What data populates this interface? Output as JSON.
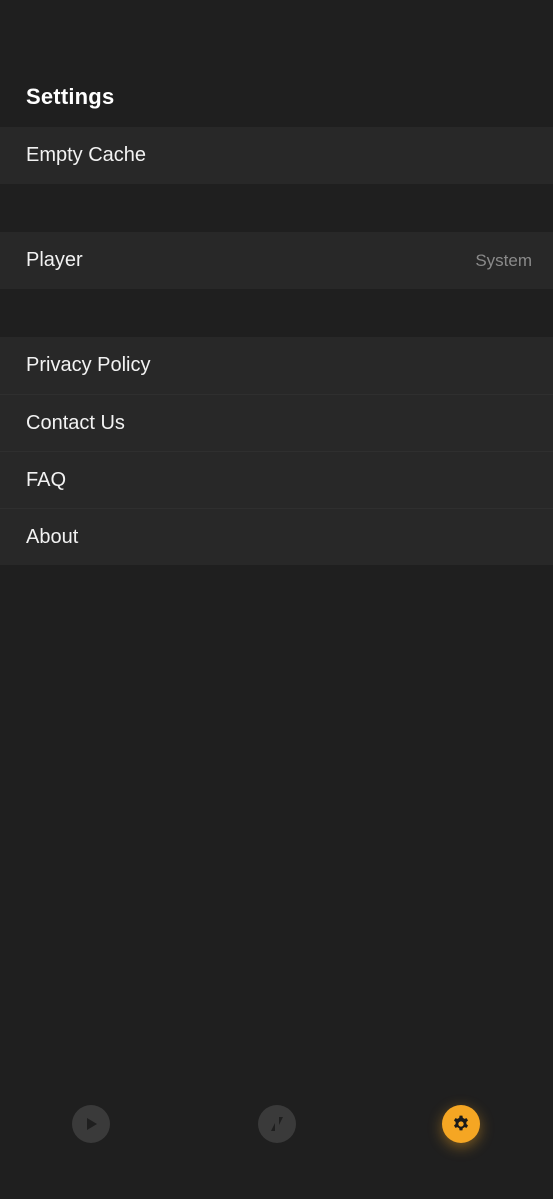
{
  "header": {
    "title": "Settings"
  },
  "groups": [
    {
      "items": [
        {
          "label": "Empty Cache"
        }
      ]
    },
    {
      "items": [
        {
          "label": "Player",
          "value": "System"
        }
      ]
    },
    {
      "items": [
        {
          "label": "Privacy Policy"
        },
        {
          "label": "Contact Us"
        },
        {
          "label": "FAQ"
        },
        {
          "label": "About"
        }
      ]
    }
  ],
  "tabbar": {
    "tabs": [
      {
        "icon": "play-icon",
        "active": false
      },
      {
        "icon": "transfer-icon",
        "active": false
      },
      {
        "icon": "gear-icon",
        "active": true
      }
    ]
  },
  "colors": {
    "background": "#1f1f1f",
    "row": "#282828",
    "accent": "#f5a623",
    "inactive_tab": "#3a3a3a",
    "secondary_text": "#8a8a8a"
  }
}
